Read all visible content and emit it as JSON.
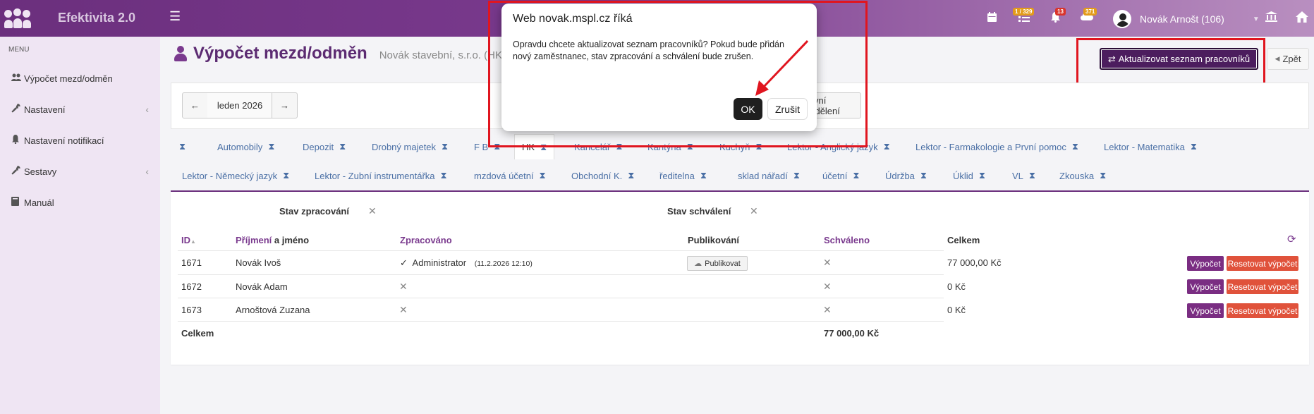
{
  "app": {
    "title": "Efektivita 2.0"
  },
  "topbar": {
    "badge_tasks": "1 / 329",
    "badge_notifications": "13",
    "badge_alerts": "371",
    "user_name": "Novák Arnošt (106)",
    "icons": [
      "calendar-icon",
      "tasks-icon",
      "bell-icon",
      "cloud-icon",
      "bank-icon",
      "home-icon"
    ]
  },
  "sidebar": {
    "menu_label": "MENU",
    "items": [
      {
        "label": "Výpočet mezd/odměn",
        "icon": "users-icon"
      },
      {
        "label": "Nastavení",
        "icon": "wrench-icon"
      },
      {
        "label": "Nastavení notifikací",
        "icon": "bell-icon"
      },
      {
        "label": "Sestavy",
        "icon": "wrench-icon"
      },
      {
        "label": "Manuál",
        "icon": "book-icon"
      }
    ]
  },
  "page": {
    "title": "Výpočet mezd/odměn",
    "subtitle": "Novák stavební, s.r.o. (HK",
    "update_button": "Aktualizovat seznam pracovníků",
    "back_button": "Zpět"
  },
  "period": {
    "label": "leden 2026",
    "dept_button": "ktivní oddělení"
  },
  "tabs": {
    "row1": [
      "Automobily",
      "Depozit",
      "Drobný majetek",
      "F B",
      "HK",
      "Kancelář",
      "Kantýna",
      "Kuchyň",
      "Lektor - Anglický jazyk",
      "Lektor - Farmakologie a První pomoc",
      "Lektor - Matematika"
    ],
    "row2": [
      "Lektor - Německý jazyk",
      "Lektor - Zubní instrumentářka",
      "mzdová účetní",
      "Obchodní K.",
      "ředitelna",
      "sklad nářadí",
      "účetní",
      "Údržba",
      "Úklid",
      "VL",
      "Zkouska"
    ],
    "active": "HK"
  },
  "filters": {
    "processing": "Stav zpracování",
    "approval": "Stav schválení"
  },
  "table": {
    "headers": {
      "id": "ID",
      "name_a": "Příjmení",
      "name_b": " a jméno",
      "processed": "Zpracováno",
      "publishing": "Publikování",
      "approved": "Schváleno",
      "total": "Celkem"
    },
    "rows": [
      {
        "id": "1671",
        "name": "Novák Ivoš",
        "processed_by": "Administrator",
        "processed_at": "(11.2.2026 12:10)",
        "total": "77 000,00 Kč"
      },
      {
        "id": "1672",
        "name": "Novák Adam",
        "processed_by": "",
        "processed_at": "",
        "total": "0 Kč"
      },
      {
        "id": "1673",
        "name": "Arnoštová Zuzana",
        "processed_by": "",
        "processed_at": "",
        "total": "0 Kč"
      }
    ],
    "publish_button": "Publikovat",
    "calc_button": "Výpočet",
    "reset_button": "Resetovat výpočet",
    "footer_label": "Celkem",
    "footer_total": "77 000,00 Kč"
  },
  "dialog": {
    "title": "Web novak.mspl.cz říká",
    "message": "Opravdu chcete aktualizovat seznam pracovníků? Pokud bude přidán nový zaměstnanec, stav zpracování a schválení bude zrušen.",
    "ok": "OK",
    "cancel": "Zrušit"
  },
  "colors": {
    "brand": "#6b2f7d",
    "highlight": "#e0151f",
    "calc": "#7a2d82",
    "reset": "#e0523b"
  }
}
